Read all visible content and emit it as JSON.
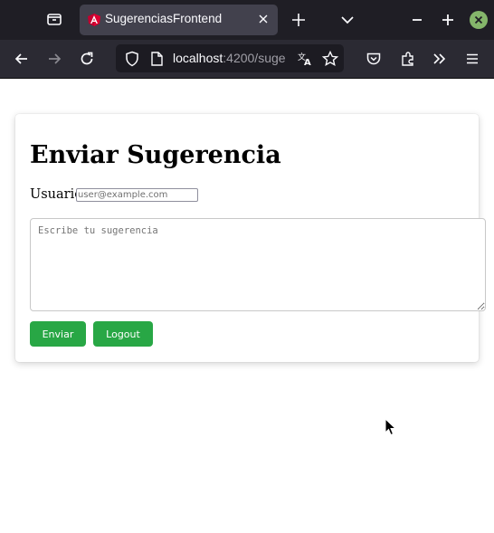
{
  "browser": {
    "tab_title": "SugerenciasFrontend",
    "url_host": "localhost",
    "url_rest": ":4200/suge"
  },
  "page": {
    "heading": "Enviar Sugerencia",
    "user_label": "Usuario",
    "user_placeholder": "user@example.com",
    "suggestion_placeholder": "Escribe tu sugerencia",
    "submit_label": "Enviar",
    "logout_label": "Logout"
  },
  "colors": {
    "button": "#28a745",
    "tabbar": "#1f1e25",
    "navbar": "#2b2a33"
  }
}
